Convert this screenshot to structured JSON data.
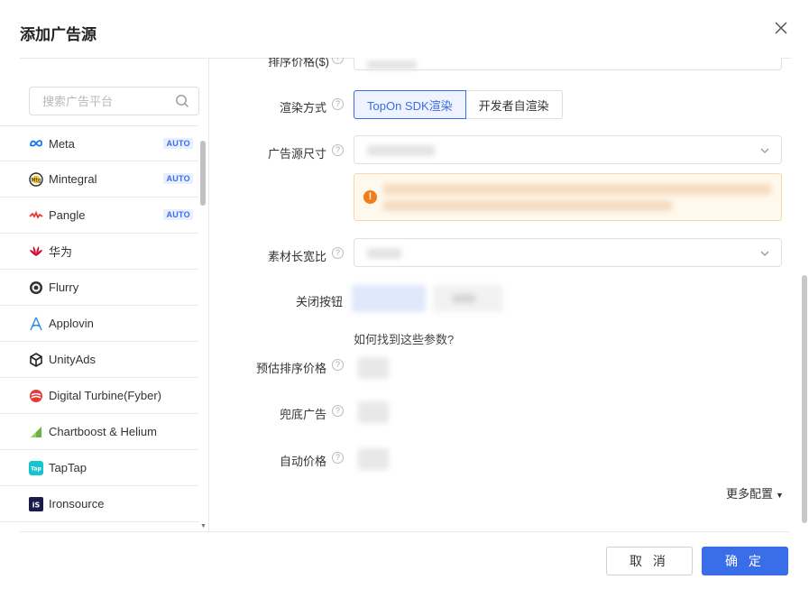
{
  "dialog": {
    "title": "添加广告源"
  },
  "search": {
    "placeholder": "搜索广告平台"
  },
  "platforms": [
    {
      "name": "Meta",
      "badge": "AUTO",
      "icon": "meta-icon",
      "color": "#1877f2"
    },
    {
      "name": "Mintegral",
      "badge": "AUTO",
      "icon": "mintegral-icon",
      "color": "#2a2a2a"
    },
    {
      "name": "Pangle",
      "badge": "AUTO",
      "icon": "pangle-icon",
      "color": "#e53935"
    },
    {
      "name": "华为",
      "badge": "",
      "icon": "huawei-icon",
      "color": "#cf0a2c"
    },
    {
      "name": "Flurry",
      "badge": "",
      "icon": "flurry-icon",
      "color": "#333333"
    },
    {
      "name": "Applovin",
      "badge": "",
      "icon": "applovin-icon",
      "color": "#2b8ce0"
    },
    {
      "name": "UnityAds",
      "badge": "",
      "icon": "unity-icon",
      "color": "#222222"
    },
    {
      "name": "Digital Turbine(Fyber)",
      "badge": "",
      "icon": "digital-turbine-icon",
      "color": "#e53935"
    },
    {
      "name": "Chartboost & Helium",
      "badge": "",
      "icon": "chartboost-icon",
      "color": "#6db33f"
    },
    {
      "name": "TapTap",
      "badge": "",
      "icon": "taptap-icon",
      "color": "#15c5ce"
    },
    {
      "name": "Ironsource",
      "badge": "",
      "icon": "ironsource-icon",
      "color": "#1c1c4c"
    }
  ],
  "form": {
    "partial_top_label": "排序价格($)",
    "render_label": "渲染方式",
    "render_options": [
      "TopOn SDK渲染",
      "开发者自渲染"
    ],
    "ad_size_label": "广告源尺寸",
    "aspect_label": "素材长宽比",
    "close_btn_label": "关闭按钮",
    "help_link": "如何找到这些参数?",
    "est_price_label": "预估排序价格",
    "fallback_label": "兜底广告",
    "auto_price_label": "自动价格",
    "more_config": "更多配置"
  },
  "footer": {
    "cancel": "取 消",
    "ok": "确 定"
  },
  "colors": {
    "primary": "#3a6de8",
    "warning": "#f07c1a"
  }
}
